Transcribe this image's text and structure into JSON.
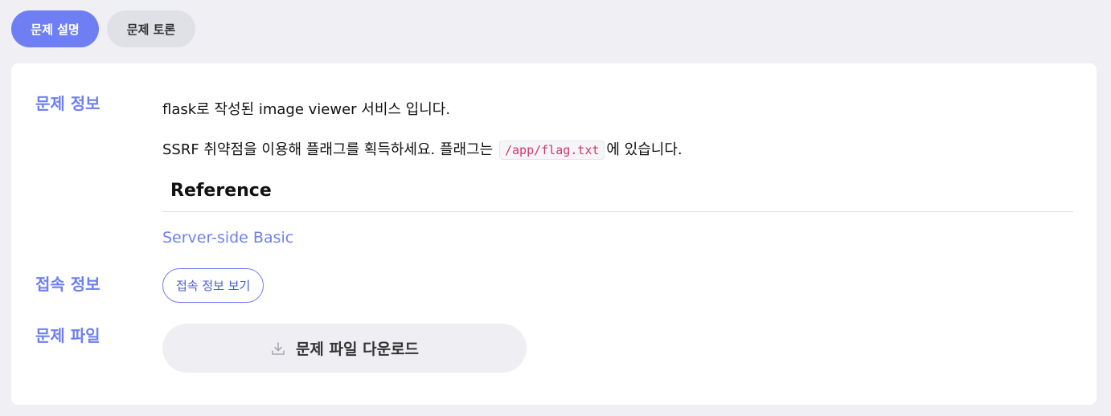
{
  "tabs": [
    {
      "label": "문제 설명",
      "active": true
    },
    {
      "label": "문제 토론",
      "active": false
    }
  ],
  "sections": {
    "info_label": "문제 정보",
    "connection_label": "접속 정보",
    "file_label": "문제 파일"
  },
  "description": {
    "line1": "flask로 작성된 image viewer 서비스 입니다.",
    "line2_before": "SSRF 취약점을 이용해 플래그를 획득하세요. 플래그는",
    "line2_code": "/app/flag.txt",
    "line2_after": "에 있습니다."
  },
  "reference": {
    "title": "Reference",
    "link": "Server-side Basic"
  },
  "buttons": {
    "connection": "접속 정보 보기",
    "download": "문제 파일 다운로드",
    "download_icon": "download-icon"
  },
  "colors": {
    "accent": "#6e7ff3",
    "background": "#efeff4",
    "code": "#d6336c"
  }
}
